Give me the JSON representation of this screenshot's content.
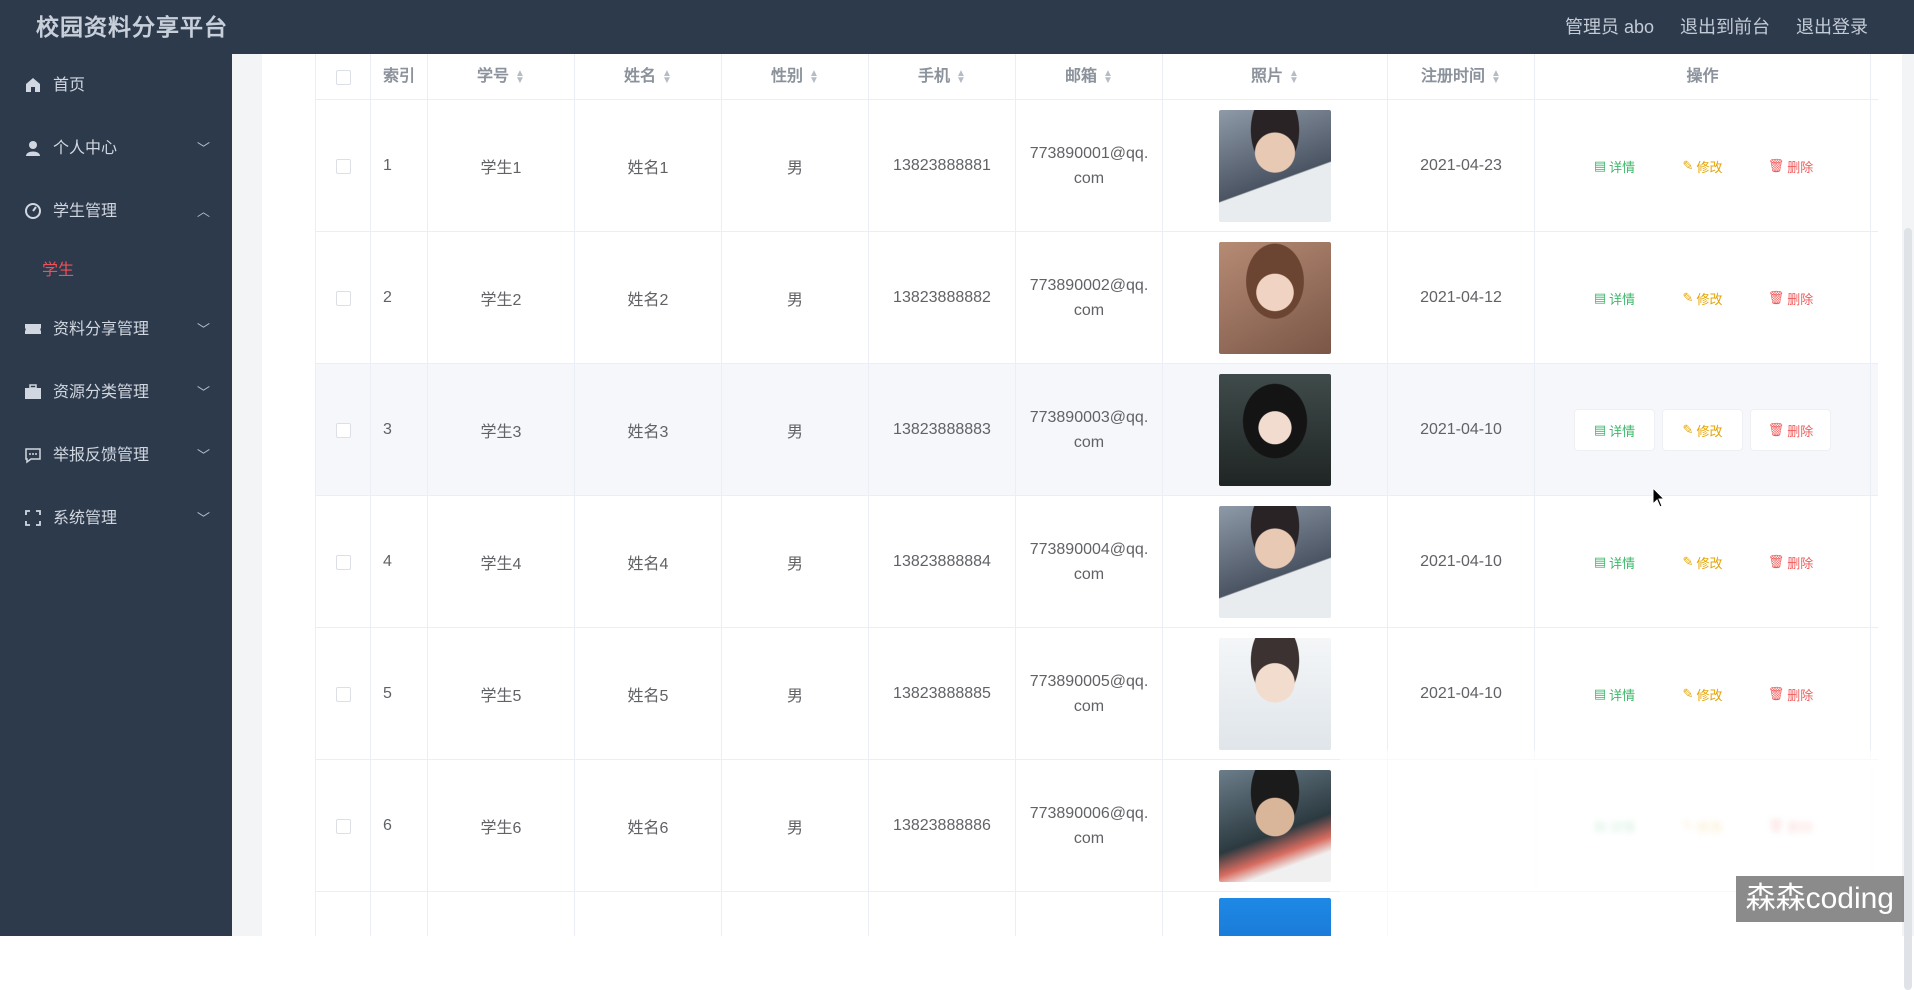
{
  "header": {
    "brand": "校园资料分享平台",
    "user": "管理员 abo",
    "frontend": "退出到前台",
    "logout": "退出登录"
  },
  "sidebar": {
    "items": [
      {
        "label": "首页",
        "icon": "home-icon",
        "chevron": ""
      },
      {
        "label": "个人中心",
        "icon": "user-icon",
        "chevron": "﹀"
      },
      {
        "label": "学生管理",
        "icon": "gauge-icon",
        "chevron": "︿"
      },
      {
        "label": "资料分享管理",
        "icon": "ticket-icon",
        "chevron": "﹀"
      },
      {
        "label": "资源分类管理",
        "icon": "briefcase-icon",
        "chevron": "﹀"
      },
      {
        "label": "举报反馈管理",
        "icon": "message-icon",
        "chevron": "﹀"
      },
      {
        "label": "系统管理",
        "icon": "fullscreen-icon",
        "chevron": "﹀"
      }
    ],
    "subitem": "学生"
  },
  "table": {
    "headers": {
      "index": "索引",
      "student_no": "学号",
      "name": "姓名",
      "gender": "性别",
      "phone": "手机",
      "email": "邮箱",
      "photo": "照片",
      "reg_time": "注册时间",
      "ops": "操作"
    },
    "actions": {
      "detail": "详情",
      "edit": "修改",
      "delete": "删除"
    },
    "rows": [
      {
        "index": "1",
        "student_no": "学生1",
        "name": "姓名1",
        "gender": "男",
        "phone": "13823888881",
        "email1": "773890001@qq.",
        "email2": "com",
        "reg_time": "2021-04-23"
      },
      {
        "index": "2",
        "student_no": "学生2",
        "name": "姓名2",
        "gender": "男",
        "phone": "13823888882",
        "email1": "773890002@qq.",
        "email2": "com",
        "reg_time": "2021-04-12"
      },
      {
        "index": "3",
        "student_no": "学生3",
        "name": "姓名3",
        "gender": "男",
        "phone": "13823888883",
        "email1": "773890003@qq.",
        "email2": "com",
        "reg_time": "2021-04-10"
      },
      {
        "index": "4",
        "student_no": "学生4",
        "name": "姓名4",
        "gender": "男",
        "phone": "13823888884",
        "email1": "773890004@qq.",
        "email2": "com",
        "reg_time": "2021-04-10"
      },
      {
        "index": "5",
        "student_no": "学生5",
        "name": "姓名5",
        "gender": "男",
        "phone": "13823888885",
        "email1": "773890005@qq.",
        "email2": "com",
        "reg_time": "2021-04-10"
      },
      {
        "index": "6",
        "student_no": "学生6",
        "name": "姓名6",
        "gender": "男",
        "phone": "13823888886",
        "email1": "773890006@qq.",
        "email2": "com",
        "reg_time": ""
      }
    ]
  },
  "watermark": "森森coding",
  "colors": {
    "sidebar_bg": "#2d3a4b",
    "active_sub": "#f0505a",
    "detail": "#3db86b",
    "edit": "#e6a400",
    "delete": "#f05a5a"
  }
}
